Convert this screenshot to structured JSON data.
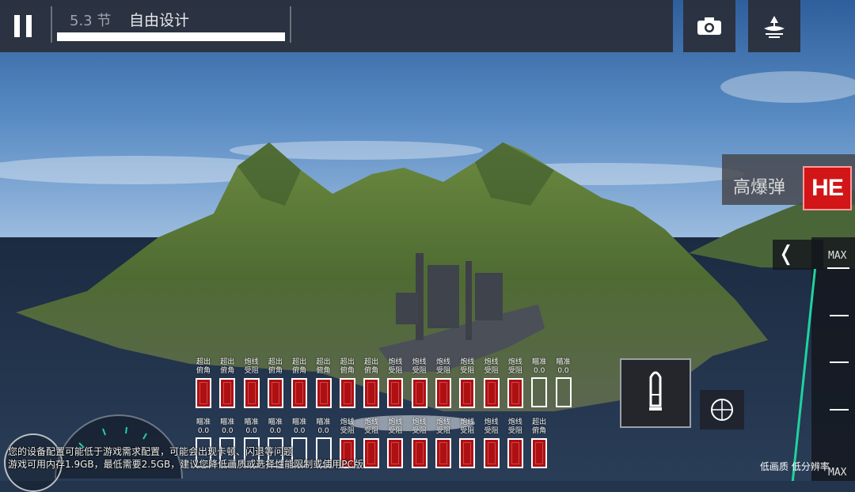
{
  "hud": {
    "speed_text": "5.3 节",
    "mode_title": "自由设计",
    "progress": 1.0
  },
  "icons": {
    "pause": "pause-icon",
    "camera": "camera-icon",
    "view": "island-view-icon",
    "shell": "shell-icon",
    "crosshair": "crosshair-icon",
    "chevron": "chevron-left-icon"
  },
  "ammo": {
    "label": "高爆弹",
    "badge": "HE",
    "badge_color": "#d21517"
  },
  "throttle": {
    "top_label": "MAX",
    "bottom_label": "MAX"
  },
  "quality_text": "低画质 低分辨率",
  "warning": {
    "line1": "您的设备配置可能低于游戏需求配置，可能会出现卡顿、闪退等问题",
    "line2": "游戏可用内存1.9GB，最低需要2.5GB，建议您降低画质或选择性能限制或使用PC版"
  },
  "slots_top": [
    {
      "label": "超出\n俯角",
      "value": "",
      "state": "red"
    },
    {
      "label": "超出\n俯角",
      "value": "",
      "state": "red"
    },
    {
      "label": "炮线\n受阻",
      "value": "",
      "state": "red"
    },
    {
      "label": "超出\n俯角",
      "value": "",
      "state": "red"
    },
    {
      "label": "超出\n俯角",
      "value": "",
      "state": "red"
    },
    {
      "label": "超出\n俯角",
      "value": "",
      "state": "red"
    },
    {
      "label": "超出\n俯角",
      "value": "",
      "state": "red"
    },
    {
      "label": "超出\n俯角",
      "value": "",
      "state": "red"
    },
    {
      "label": "炮线\n受阻",
      "value": "",
      "state": "red"
    },
    {
      "label": "炮线\n受阻",
      "value": "",
      "state": "red"
    },
    {
      "label": "炮线\n受阻",
      "value": "",
      "state": "red"
    },
    {
      "label": "炮线\n受阻",
      "value": "",
      "state": "red"
    },
    {
      "label": "炮线\n受阻",
      "value": "",
      "state": "red"
    },
    {
      "label": "炮线\n受阻",
      "value": "",
      "state": "red"
    },
    {
      "label": "瞄准",
      "value": "0.0",
      "state": "empty"
    },
    {
      "label": "瞄准",
      "value": "0.0",
      "state": "empty"
    }
  ],
  "slots_bottom": [
    {
      "label": "瞄准",
      "value": "0.0",
      "state": "empty"
    },
    {
      "label": "瞄准",
      "value": "0.0",
      "state": "empty"
    },
    {
      "label": "瞄准",
      "value": "0.0",
      "state": "empty"
    },
    {
      "label": "瞄准",
      "value": "0.0",
      "state": "empty"
    },
    {
      "label": "瞄准",
      "value": "0.0",
      "state": "empty"
    },
    {
      "label": "瞄准",
      "value": "0.0",
      "state": "empty"
    },
    {
      "label": "炮线\n受阻",
      "value": "",
      "state": "red"
    },
    {
      "label": "炮线\n受阻",
      "value": "",
      "state": "red"
    },
    {
      "label": "炮线\n受阻",
      "value": "",
      "state": "red"
    },
    {
      "label": "炮线\n受阻",
      "value": "",
      "state": "red"
    },
    {
      "label": "炮线\n受阻",
      "value": "",
      "state": "red"
    },
    {
      "label": "炮线\n受阻",
      "value": "",
      "state": "red"
    },
    {
      "label": "炮线\n受阻",
      "value": "",
      "state": "red"
    },
    {
      "label": "炮线\n受阻",
      "value": "",
      "state": "red"
    },
    {
      "label": "超出\n俯角",
      "value": "",
      "state": "red"
    }
  ]
}
